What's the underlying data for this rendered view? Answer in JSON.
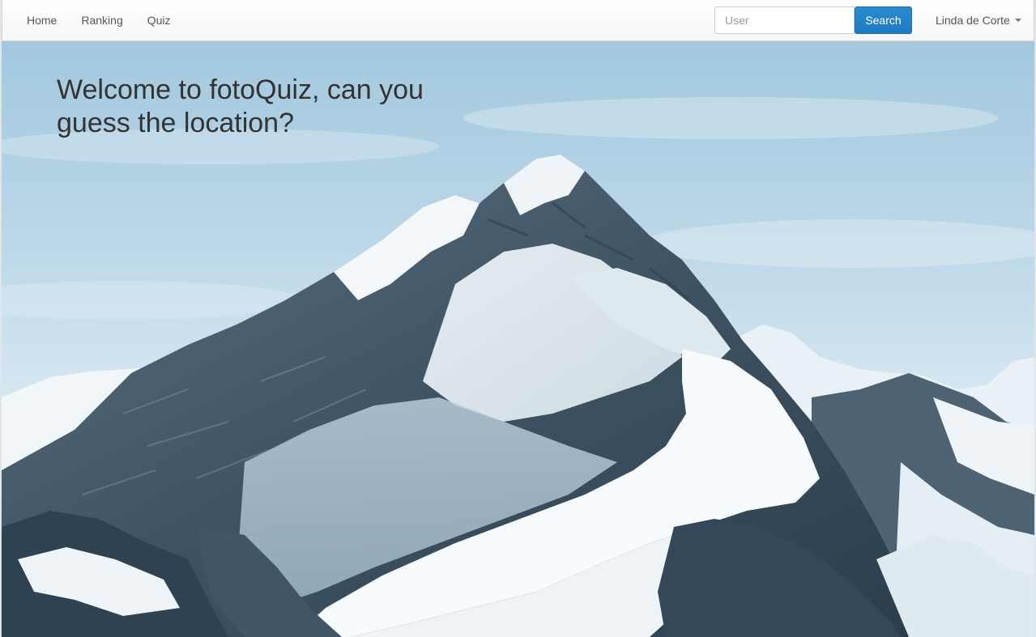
{
  "navbar": {
    "links": [
      {
        "label": "Home"
      },
      {
        "label": "Ranking"
      },
      {
        "label": "Quiz"
      }
    ],
    "search": {
      "placeholder": "User",
      "value": "",
      "button_label": "Search"
    },
    "user": {
      "name": "Linda de Corte"
    }
  },
  "hero": {
    "title": "Welcome to fotoQuiz, can you guess the location?",
    "image": "snow-capped-mountain-photo"
  },
  "colors": {
    "primary_button": "#1f7bbf",
    "title_text": "#333333",
    "nav_text": "#555555"
  }
}
